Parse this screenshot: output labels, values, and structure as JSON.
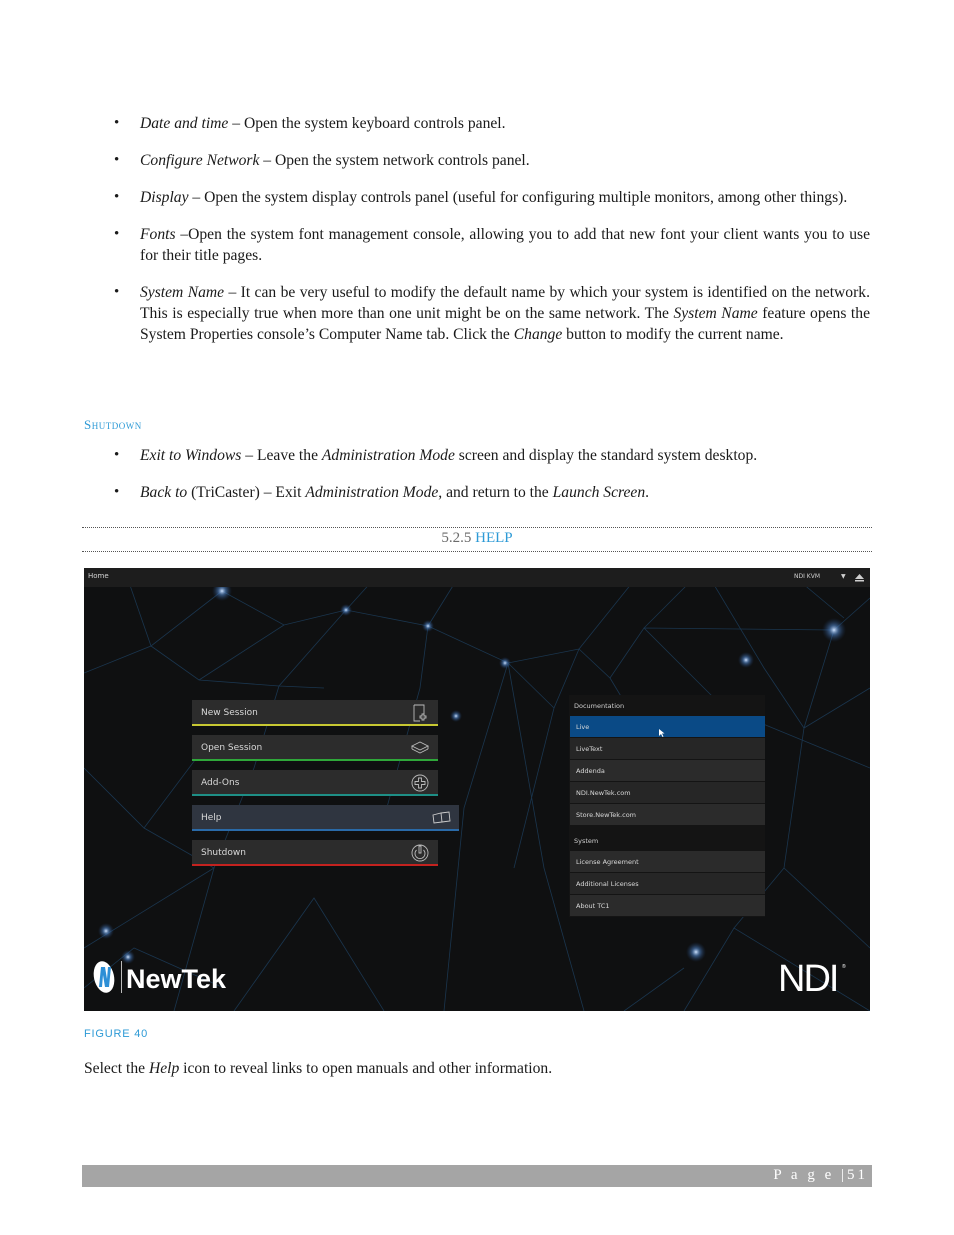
{
  "bullets_top": [
    {
      "term": "Date and time",
      "text": " – Open the system keyboard controls panel."
    },
    {
      "term": "Configure Network",
      "text": " – Open the system network controls panel."
    },
    {
      "term": "Display",
      "text": " – Open the system display controls panel (useful for configuring multiple monitors, among other things)."
    },
    {
      "term": "Fonts",
      "text": " –Open the system font management console, allowing you to add that new font your client wants you to use for their title pages."
    },
    {
      "term": "System Name",
      "text_1": " – It can be very useful to modify the default name by which your system is identified on the network.  This is especially true when more than one unit might be on the same network. The ",
      "term_2": "System Name",
      "text_2": " feature opens the System Properties console’s Computer Name tab.  Click the ",
      "term_3": "Change",
      "text_3": " button to modify the current name."
    }
  ],
  "shutdown_heading": "Shutdown",
  "bullets_shutdown": [
    {
      "term": "Exit to Windows",
      "text_1": " – Leave the ",
      "term_2": "Administration Mode",
      "text_2": " screen and display the standard system desktop."
    },
    {
      "term": "Back to",
      "text_1": " (TriCaster) – Exit ",
      "term_2": "Administration Mode",
      "text_2": ", and return to the ",
      "term_3": "Launch Screen",
      "text_3": "."
    }
  ],
  "section": {
    "number": "5.2.5",
    "title": "HELP"
  },
  "screenshot": {
    "topbar": {
      "home_label": "Home",
      "device_label": "NDI KVM",
      "device_dropdown_icon": "caret-down-icon",
      "eject_icon": "eject-icon"
    },
    "menu_buttons": [
      {
        "label": "New Session",
        "icon": "new-session-icon",
        "accent": "#c8c832"
      },
      {
        "label": "Open Session",
        "icon": "open-session-icon",
        "accent": "#2fa83a"
      },
      {
        "label": "Add-Ons",
        "icon": "add-ons-icon",
        "accent": "#1e8f86"
      },
      {
        "label": "Help",
        "icon": "help-book-icon",
        "accent": "#2a6aa8",
        "active": true
      },
      {
        "label": "Shutdown",
        "icon": "power-icon",
        "accent": "#c4221f"
      }
    ],
    "documentation": {
      "label": "Documentation",
      "items": [
        "Live",
        "LiveText",
        "Addenda",
        "NDI.NewTek.com",
        "Store.NewTek.com"
      ],
      "selected": "Live"
    },
    "system": {
      "label": "System",
      "items": [
        "License Agreement",
        "Additional Licenses",
        "About TC1"
      ]
    },
    "logos": {
      "left": "NewTek",
      "right": "NDI"
    }
  },
  "figure_caption": "FIGURE 40",
  "body_text": {
    "pre": "Select the ",
    "term": "Help",
    "post": " icon to reveal links to open manuals and other information."
  },
  "footer": {
    "page_label": "P a g e",
    "separator": "|",
    "page_number": "51"
  }
}
